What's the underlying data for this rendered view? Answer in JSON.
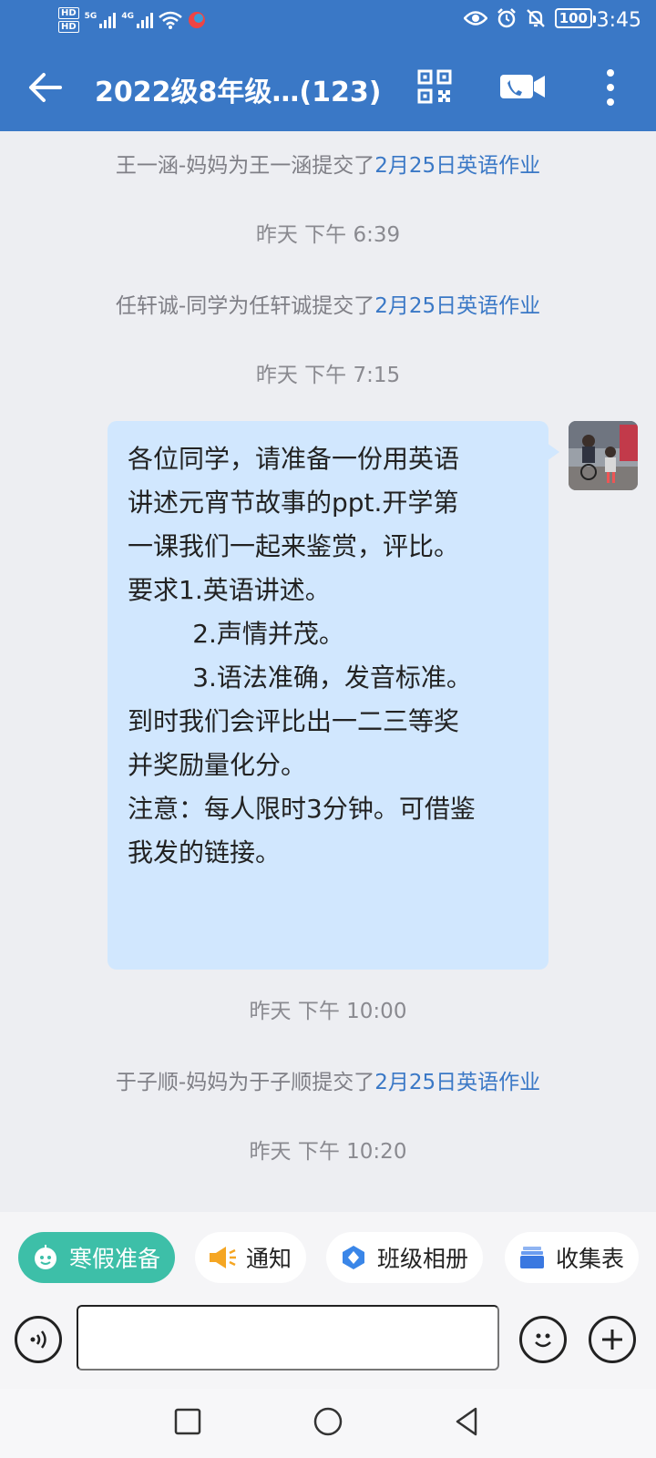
{
  "status_bar": {
    "hd_labels": [
      "HD",
      "HD"
    ],
    "net1": "5G",
    "net2": "4G",
    "battery": "100",
    "time": "3:45"
  },
  "header": {
    "title": "2022级8年级…(123)"
  },
  "chat": {
    "events": [
      {
        "prefix": "王一涵-妈妈为王一涵提交了",
        "link": "2月25日英语作业"
      },
      {
        "time": "昨天  下午 6:39"
      },
      {
        "prefix": "任轩诚-同学为任轩诚提交了",
        "link": "2月25日英语作业"
      },
      {
        "time": "昨天  下午 7:15"
      },
      {
        "time": "昨天  下午 10:00"
      },
      {
        "prefix": "于子顺-妈妈为于子顺提交了",
        "link": "2月25日英语作业"
      },
      {
        "time": "昨天  下午 10:20"
      }
    ],
    "message": {
      "lines": [
        "各位同学，请准备一份用英语",
        "讲述元宵节故事的ppt.开学第",
        "一课我们一起来鉴赏，评比。",
        "要求1.英语讲述。",
        "        2.声情并茂。",
        "        3.语法准确，发音标准。",
        "到时我们会评比出一二三等奖",
        "并奖励量化分。",
        "",
        "",
        "注意：每人限时3分钟。可借鉴",
        "我发的链接。"
      ]
    }
  },
  "quick_actions": [
    {
      "label": "寒假准备",
      "icon": "assistant-bot-icon"
    },
    {
      "label": "通知",
      "icon": "megaphone-icon"
    },
    {
      "label": "班级相册",
      "icon": "album-icon"
    },
    {
      "label": "收集表",
      "icon": "form-stack-icon"
    }
  ],
  "input": {
    "placeholder": ""
  },
  "colors": {
    "header": "#3a78c6",
    "chat_bg": "#edeef2",
    "bubble": "#d1e7fe",
    "link": "#3a78c6",
    "primary_chip": "#3dbfa8"
  }
}
